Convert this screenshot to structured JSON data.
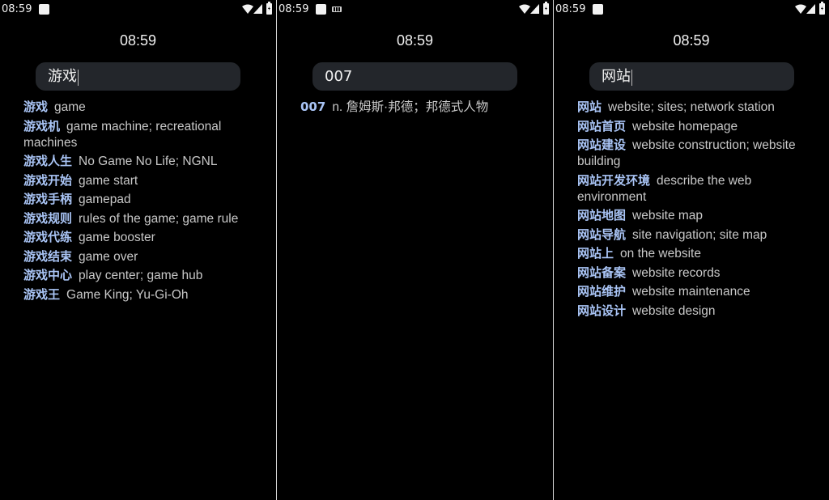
{
  "panels": [
    {
      "status_time": "08:59",
      "clock": "08:59",
      "query": "游戏",
      "results": [
        {
          "term": "游戏",
          "definition": "game"
        },
        {
          "term": "游戏机",
          "definition": "game machine; recreational machines"
        },
        {
          "term": "游戏人生",
          "definition": "No Game No Life;  NGNL"
        },
        {
          "term": "游戏开始",
          "definition": "game start"
        },
        {
          "term": "游戏手柄",
          "definition": "gamepad"
        },
        {
          "term": "游戏规则",
          "definition": "rules of the game; game rule"
        },
        {
          "term": "游戏代练",
          "definition": "game booster"
        },
        {
          "term": "游戏结束",
          "definition": "game over"
        },
        {
          "term": "游戏中心",
          "definition": "play center; game hub"
        },
        {
          "term": "游戏王",
          "definition": "Game King; Yu-Gi-Oh"
        }
      ]
    },
    {
      "status_time": "08:59",
      "clock": "08:59",
      "query": "007",
      "results": [
        {
          "term": "007",
          "definition": "n. 詹姆斯·邦德；邦德式人物"
        }
      ]
    },
    {
      "status_time": "08:59",
      "clock": "08:59",
      "query": "网站",
      "results": [
        {
          "term": "网站",
          "definition": "website; sites; network station"
        },
        {
          "term": "网站首页",
          "definition": "website homepage"
        },
        {
          "term": "网站建设",
          "definition": "website construction; website building"
        },
        {
          "term": "网站开发环境",
          "definition": "describe the web environment"
        },
        {
          "term": "网站地图",
          "definition": "website map"
        },
        {
          "term": "网站导航",
          "definition": "site navigation; site map"
        },
        {
          "term": "网站上",
          "definition": "on the website"
        },
        {
          "term": "网站备案",
          "definition": "website records"
        },
        {
          "term": "网站维护",
          "definition": "website maintenance"
        },
        {
          "term": "网站设计",
          "definition": "website design"
        }
      ]
    }
  ],
  "icons": {
    "notification": "square-notification-icon",
    "keyboard": "keyboard-icon",
    "wifi": "wifi-icon",
    "signal": "cell-signal-icon",
    "battery": "battery-charging-icon"
  },
  "colors": {
    "background": "#000000",
    "search_bg": "#23262b",
    "term": "#a9c4f5",
    "definition": "#c8c8c8"
  }
}
